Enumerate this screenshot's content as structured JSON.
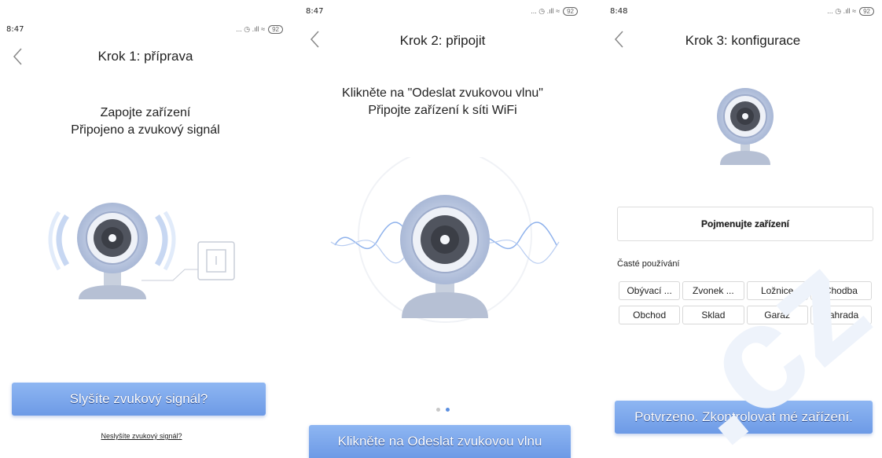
{
  "screen1": {
    "status": {
      "time": "8:47",
      "icons": "... ◷ .ıll ≈",
      "battery": "92"
    },
    "title": "Krok 1: příprava",
    "desc_line1": "Zapojte zařízení",
    "desc_line2": "Připojeno a zvukový signál",
    "primary_button": "Slyšíte zvukový signál?",
    "secondary_link": "Neslyšíte zvukový signál?"
  },
  "screen2": {
    "status": {
      "time": "8:47",
      "icons": "... ◷ .ıll ≈",
      "battery": "92"
    },
    "title": "Krok 2: připojit",
    "desc_line1": "Klikněte na \"Odeslat zvukovou vlnu\"",
    "desc_line2": "Připojte zařízení k síti WiFi",
    "primary_button": "Klikněte na Odeslat zvukovou vlnu"
  },
  "screen3": {
    "status": {
      "time": "8:48",
      "icons": "... ◷ .ıll ≈",
      "battery": "92"
    },
    "title": "Krok 3: konfigurace",
    "name_field": "Pojmenujte zařízení",
    "section_label": "Časté používání",
    "chips": [
      "Obývací ...",
      "Zvonek ...",
      "Ložnice",
      "Chodba",
      "Obchod",
      "Sklad",
      "Garáž",
      "Zahrada"
    ],
    "primary_button": "Potvrzeno. Zkontrolovat mé zařízení."
  },
  "colors": {
    "accent": "#6d9ae6",
    "accent_light": "#8eb6f2",
    "dot_active": "#5b8fe0"
  }
}
